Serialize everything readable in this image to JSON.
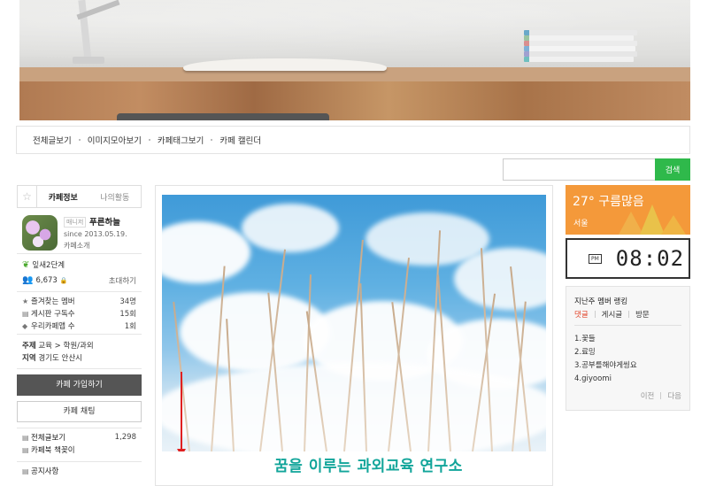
{
  "nav": {
    "items": [
      "전체글보기",
      "이미지모아보기",
      "카페태그보기",
      "카페 캘린더"
    ]
  },
  "search": {
    "value": "",
    "placeholder": "",
    "button_label": "검색"
  },
  "sidebar": {
    "tabs": {
      "star_icon": "star-icon",
      "info": "카페정보",
      "activity": "나의활동"
    },
    "profile": {
      "role": "매니저",
      "nickname": "푸른하늘",
      "since": "since 2013.05.19.",
      "intro": "카페소개"
    },
    "level": "잎새2단계",
    "members": {
      "count": "6,673",
      "invite": "초대하기"
    },
    "stats": [
      {
        "icon": "★",
        "label": "즐겨찾는 멤버",
        "value": "34명"
      },
      {
        "icon": "▤",
        "label": "게시판 구독수",
        "value": "15회"
      },
      {
        "icon": "◆",
        "label": "우리카페앱 수",
        "value": "1회"
      }
    ],
    "topic": {
      "subject_label": "주제",
      "subject": "교육 > 학원/과외",
      "region_label": "지역",
      "region": "경기도 안산시"
    },
    "join_label": "카페 가입하기",
    "chat_label": "카페 채팅",
    "menu": [
      {
        "icon": "▤",
        "label": "전체글보기",
        "count": "1,298"
      },
      {
        "icon": "▤",
        "label": "카페북 책꽂이",
        "count": ""
      }
    ],
    "notice_label": "공지사항"
  },
  "main": {
    "caption": "꿈을 이루는 과외교육 연구소",
    "accent_color": "#12a59a",
    "arrow_color": "#e02020"
  },
  "weather": {
    "temp": "27° 구름많음",
    "location": "서울",
    "bg_color": "#f4993a"
  },
  "clock": {
    "ampm": "PM",
    "time": "08:02"
  },
  "ranking": {
    "title": "지난주 멤버 랭킹",
    "tabs": [
      "댓글",
      "게시글",
      "방문"
    ],
    "items": [
      "1.꽃들",
      "2.료밍",
      "3.공부를해야게씽요",
      "4.giyoomi"
    ],
    "prev": "이전",
    "next": "다음",
    "active_color": "#e2452b"
  }
}
